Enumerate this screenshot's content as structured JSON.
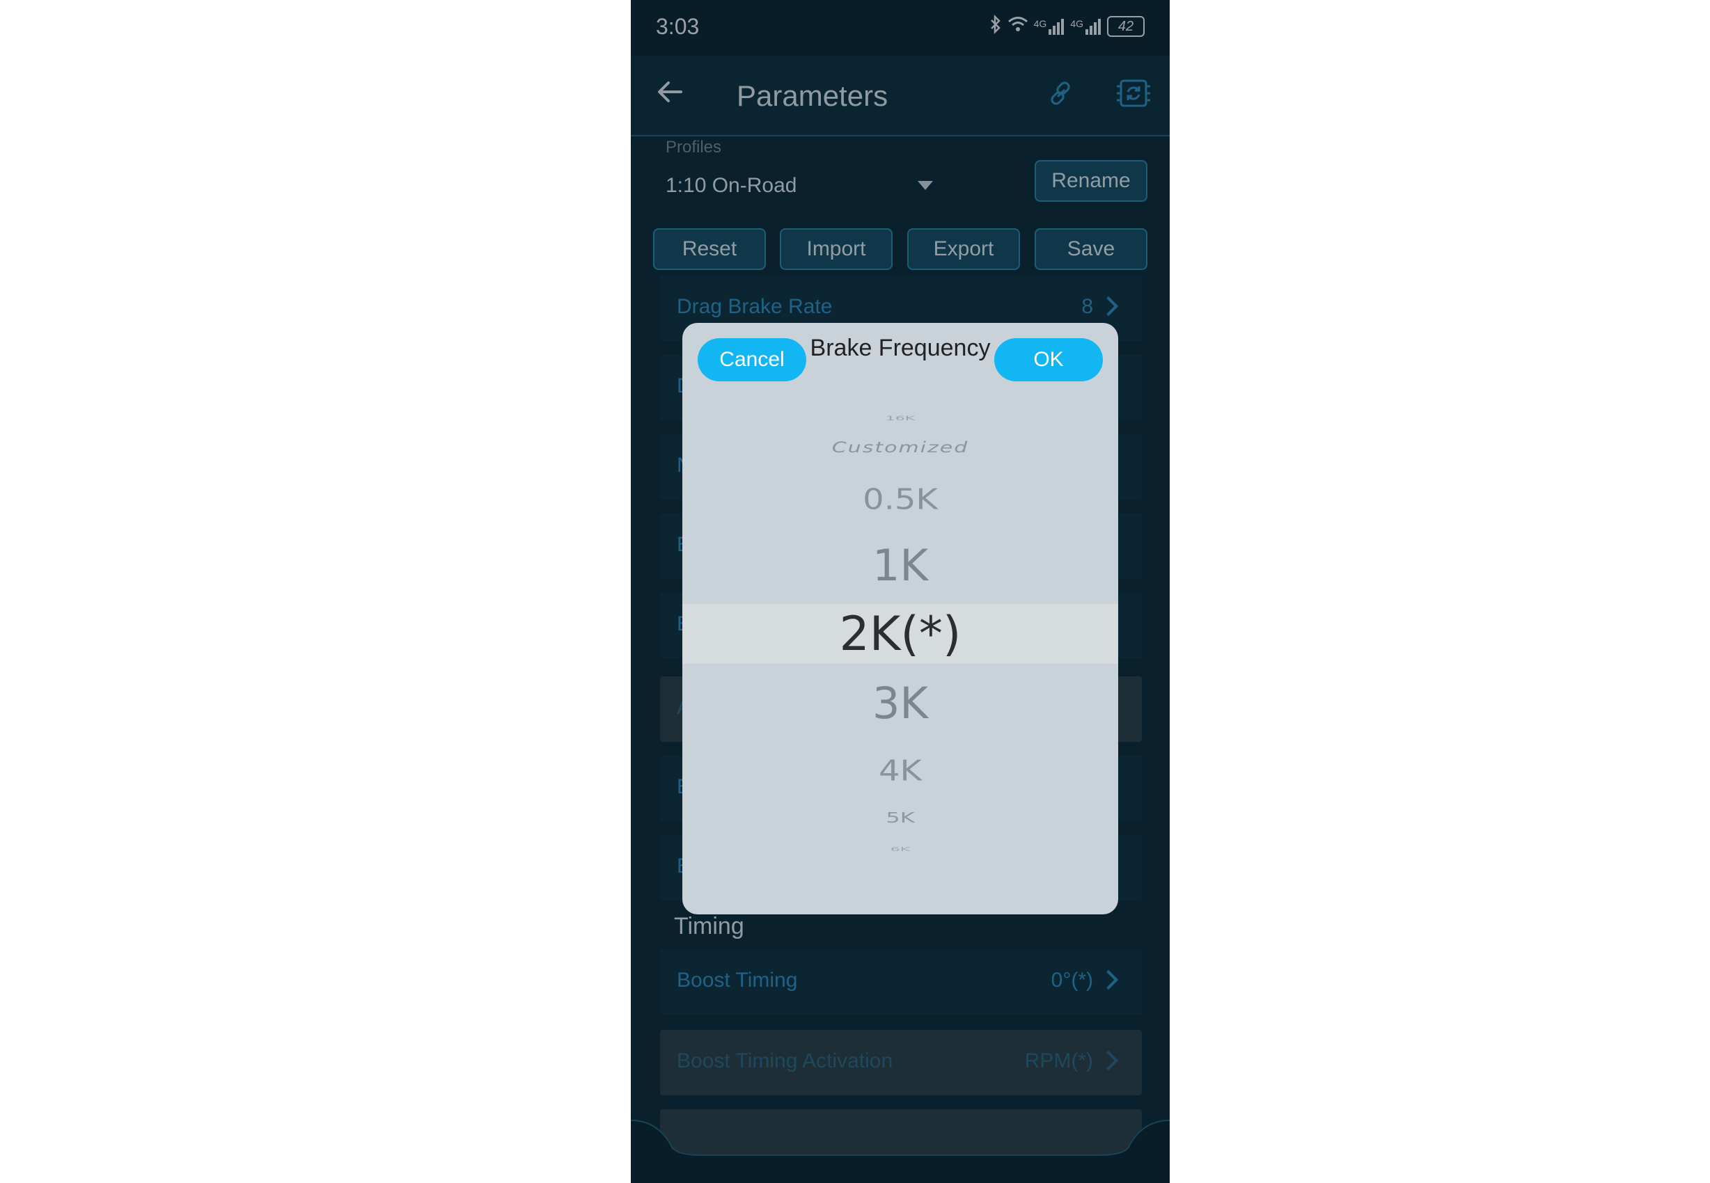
{
  "status_bar": {
    "time": "3:03",
    "icons": [
      "bluetooth-icon",
      "wifi-icon",
      "signal-4g-icon",
      "signal-4g-icon"
    ],
    "signal_label_1": "4G",
    "signal_label_2": "4G",
    "battery": "42"
  },
  "app_bar": {
    "title": "Parameters",
    "back_icon": "arrow-left-icon",
    "link_icon": "link-icon",
    "sync_icon": "sync-device-icon"
  },
  "profiles": {
    "label": "Profiles",
    "value": "1:10 On-Road",
    "rename_label": "Rename"
  },
  "actions": {
    "reset": "Reset",
    "import": "Import",
    "export": "Export",
    "save": "Save"
  },
  "rows": [
    {
      "label": "Drag Brake Rate",
      "value": "8"
    },
    {
      "partial": "D"
    },
    {
      "partial": "N"
    },
    {
      "partial": "B"
    },
    {
      "partial": "B"
    },
    {
      "partial": "A"
    },
    {
      "partial": "B"
    },
    {
      "partial": "B"
    }
  ],
  "timing": {
    "header": "Timing",
    "boost_timing_label": "Boost Timing",
    "boost_timing_value": "0°(*)",
    "boost_activation_label": "Boost Timing Activation",
    "boost_activation_value": "RPM(*)"
  },
  "dialog": {
    "title": "Brake Frequency",
    "cancel": "Cancel",
    "ok": "OK",
    "options": [
      "16K",
      "Customized",
      "0.5K",
      "1K",
      "2K(*)",
      "3K",
      "4K",
      "5K",
      "6K"
    ],
    "selected": "2K(*)"
  },
  "colors": {
    "accent": "#11b6f2",
    "background": "#0d2a38",
    "row_text": "#2f8ec0",
    "dialog_bg": "#c9d2d9"
  }
}
